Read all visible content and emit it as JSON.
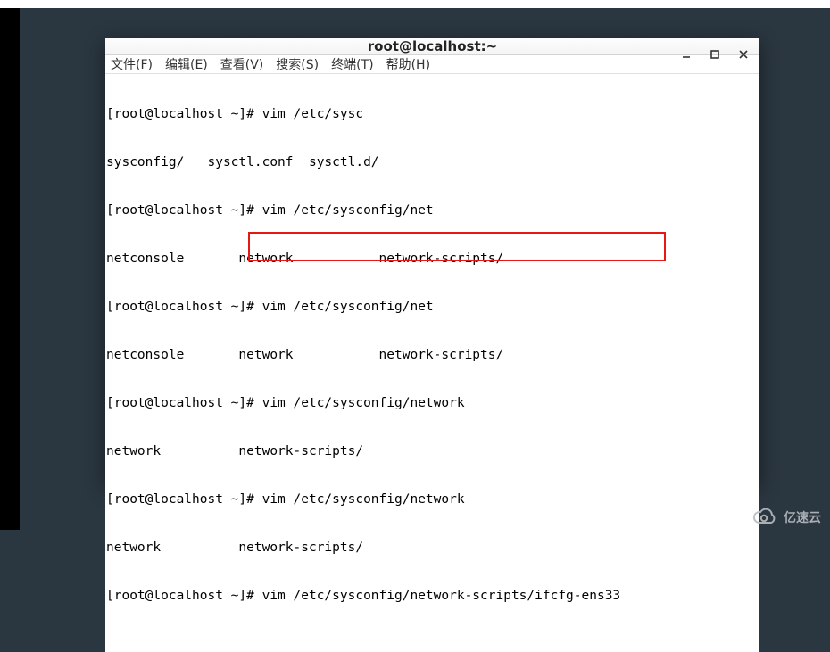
{
  "window": {
    "title": "root@localhost:~"
  },
  "menu": {
    "file": "文件(F)",
    "edit": "编辑(E)",
    "view": "查看(V)",
    "search": "搜索(S)",
    "terminal": "终端(T)",
    "help": "帮助(H)"
  },
  "prompt": "[root@localhost ~]",
  "terminal_lines": [
    "[root@localhost ~]# vim /etc/sysc",
    "sysconfig/   sysctl.conf  sysctl.d/",
    "[root@localhost ~]# vim /etc/sysconfig/net",
    "netconsole       network           network-scripts/",
    "[root@localhost ~]# vim /etc/sysconfig/net",
    "netconsole       network           network-scripts/",
    "[root@localhost ~]# vim /etc/sysconfig/network",
    "network          network-scripts/",
    "[root@localhost ~]# vim /etc/sysconfig/network",
    "network          network-scripts/",
    "[root@localhost ~]# vim /etc/sysconfig/network-scripts/ifcfg-ens33"
  ],
  "highlight_command": "# vim /etc/sysconfig/network-scripts/ifcfg-ens33",
  "watermark_text": "亿速云",
  "colors": {
    "highlight_border": "#e61717",
    "desktop_bg": "#2a3640"
  }
}
